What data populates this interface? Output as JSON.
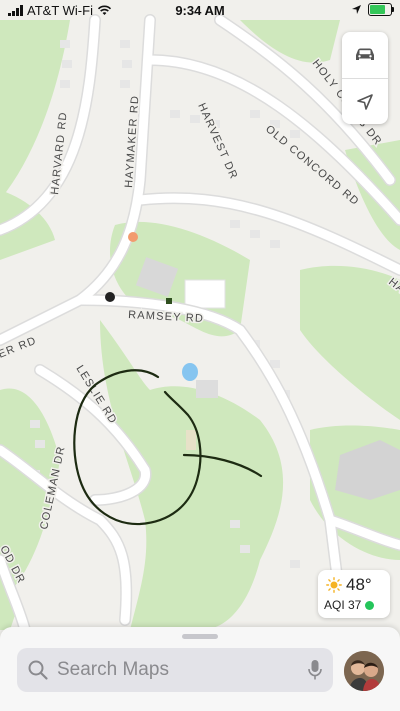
{
  "status_bar": {
    "carrier": "AT&T Wi-Fi",
    "time": "9:34 AM",
    "battery_level": 0.75,
    "wifi_icon": "wifi-icon",
    "location_icon": "location-arrow-icon",
    "battery_icon": "battery-charging-icon"
  },
  "roads": {
    "harvard": "HARVARD RD",
    "haymaker": "HAYMAKER RD",
    "harvest": "HARVEST DR",
    "old_concord": "OLD CONCORD RD",
    "holy_cross": "HOLY CROSS DR",
    "ramsey": "RAMSEY RD",
    "leslie": "LESLIE RD",
    "coleman": "COLEMAN DR",
    "partial_left": "ER RD",
    "partial_bottom_left": "OD DR",
    "partial_right": "HA"
  },
  "map_controls": {
    "driving_icon": "car-icon",
    "tracking_icon": "location-arrow-icon"
  },
  "weather": {
    "temperature": "48°",
    "aqi": "AQI 37",
    "condition_icon": "sun-icon",
    "aqi_color": "#25c55b"
  },
  "search": {
    "placeholder": "Search Maps",
    "icon": "search-icon",
    "mic_icon": "microphone-icon"
  },
  "colors": {
    "map_background": "#f1f0ec",
    "park_green": "#cfe8bd",
    "road_white": "#ffffff",
    "drawing_stroke": "#1d2b12"
  }
}
